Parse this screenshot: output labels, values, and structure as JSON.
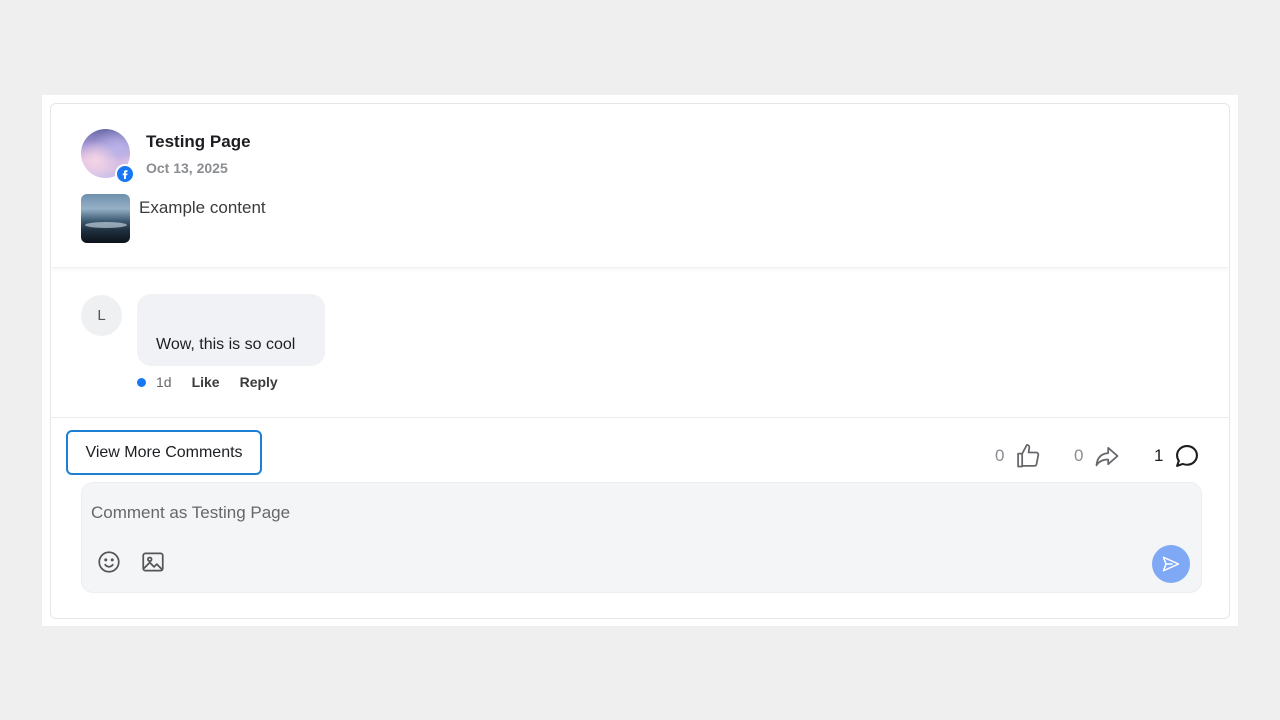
{
  "post": {
    "page_name": "Testing Page",
    "date": "Oct 13, 2025",
    "content": "Example content"
  },
  "comment": {
    "avatar_initial": "L",
    "text": "Wow, this is so cool",
    "time": "1d",
    "like_label": "Like",
    "reply_label": "Reply"
  },
  "actions": {
    "view_more_label": "View More Comments",
    "likes_count": "0",
    "shares_count": "0",
    "comments_count": "1"
  },
  "composer": {
    "placeholder": "Comment as Testing Page"
  },
  "icons": {
    "platform": "facebook-icon",
    "like": "thumbs-up-icon",
    "share": "share-arrow-icon",
    "comment": "comment-bubble-icon",
    "emoji": "emoji-icon",
    "image": "image-icon",
    "send": "send-icon"
  },
  "colors": {
    "accent": "#1877f2",
    "focus_border": "#1d7fd4",
    "send_button": "#7fa8f5",
    "background": "#efefef"
  }
}
